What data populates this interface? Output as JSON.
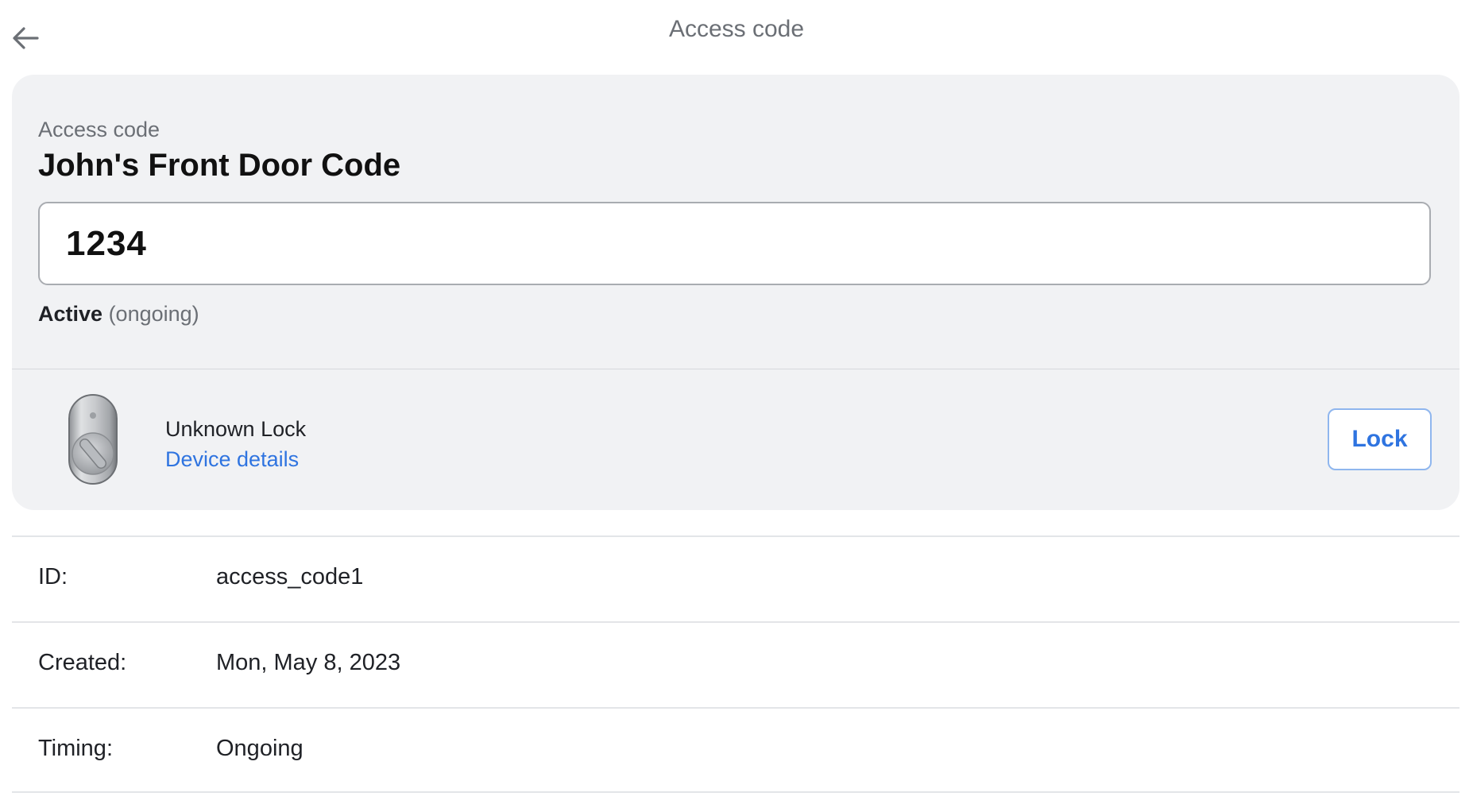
{
  "header": {
    "title": "Access code",
    "back_icon": "arrow-left-icon"
  },
  "card": {
    "label": "Access code",
    "name": "John's Front Door Code",
    "code": "1234",
    "status": "Active",
    "status_detail": "(ongoing)"
  },
  "device": {
    "image_icon": "smart-lock-icon",
    "name": "Unknown Lock",
    "link_label": "Device details",
    "action_label": "Lock"
  },
  "details": [
    {
      "key": "ID:",
      "value": "access_code1"
    },
    {
      "key": "Created:",
      "value": "Mon, May 8, 2023"
    },
    {
      "key": "Timing:",
      "value": "Ongoing"
    }
  ],
  "colors": {
    "accent": "#2f74e0",
    "card_bg": "#f1f2f4",
    "muted_text": "#6b6f75"
  }
}
